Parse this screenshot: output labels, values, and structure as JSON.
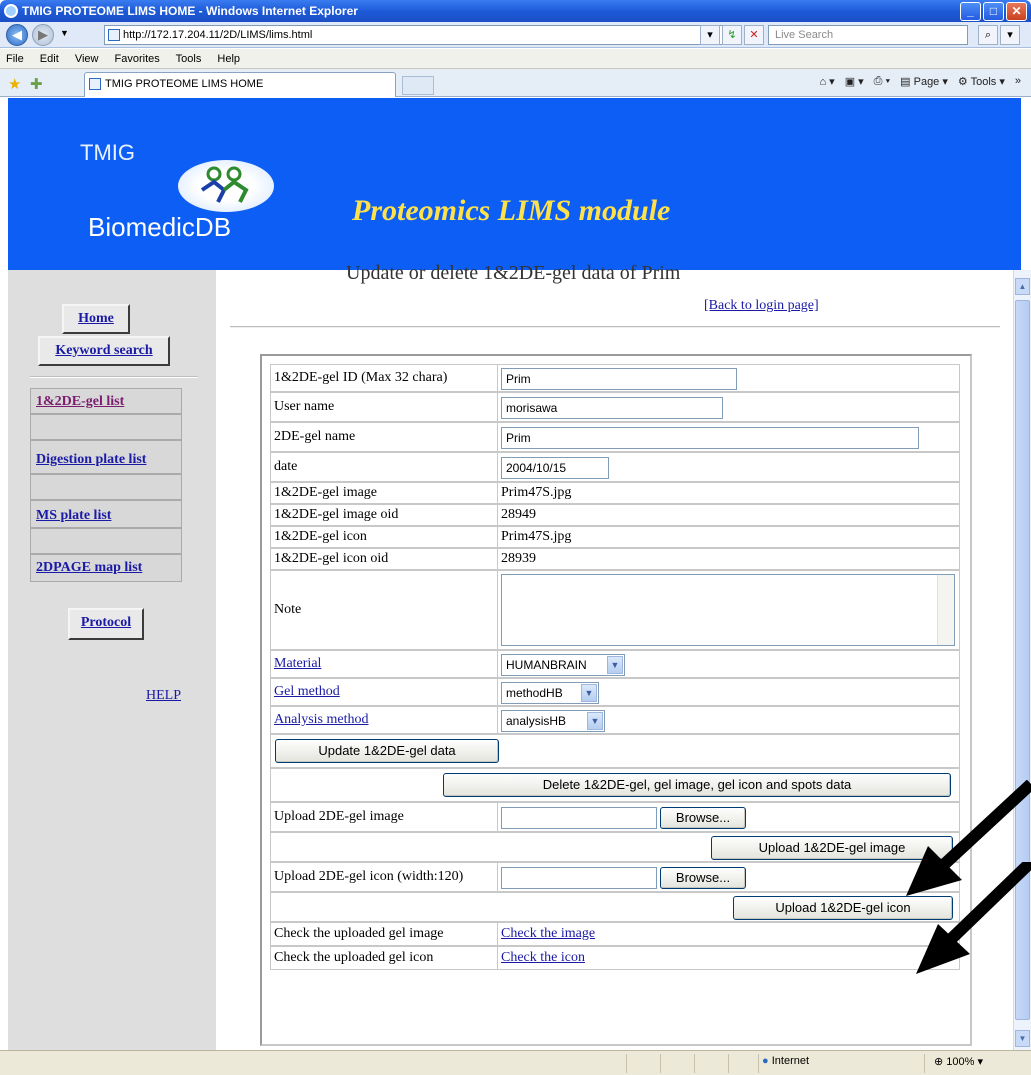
{
  "window": {
    "title": "TMIG PROTEOME LIMS HOME - Windows Internet Explorer"
  },
  "browser": {
    "url": "http://172.17.204.11/2D/LIMS/lims.html",
    "search_placeholder": "Live Search",
    "menu": [
      "File",
      "Edit",
      "View",
      "Favorites",
      "Tools",
      "Help"
    ],
    "tab_title": "TMIG PROTEOME LIMS HOME",
    "cmd_page": "Page",
    "cmd_tools": "Tools"
  },
  "banner": {
    "logo_top": "TMIG",
    "logo_bottom": "BiomedicDB",
    "title": "Proteomics LIMS module"
  },
  "sidebar": {
    "home": "Home",
    "keyword_search": "Keyword search",
    "gel_list": "1&2DE-gel list",
    "digestion_list": "Digestion plate list",
    "ms_list": "MS plate list",
    "page_map_list": "2DPAGE map list",
    "protocol": "Protocol",
    "help": "HELP"
  },
  "main": {
    "heading": "Update or delete 1&2DE-gel data of Prim",
    "back_link": "[Back to login page]"
  },
  "form": {
    "gel_id_label": "1&2DE-gel ID (Max 32 chara)",
    "gel_id_value": "Prim",
    "user_label": "User name",
    "user_value": "morisawa",
    "gel_name_label": "2DE-gel name",
    "gel_name_value": "Prim",
    "date_label": "date",
    "date_value": "2004/10/15",
    "image_label": "1&2DE-gel image",
    "image_value": "Prim47S.jpg",
    "image_oid_label": "1&2DE-gel image oid",
    "image_oid_value": "28949",
    "icon_label": "1&2DE-gel icon",
    "icon_value": "Prim47S.jpg",
    "icon_oid_label": "1&2DE-gel icon oid",
    "icon_oid_value": "28939",
    "note_label": "Note",
    "material_label": "Material",
    "material_value": "HUMANBRAIN",
    "gel_method_label": "Gel method",
    "gel_method_value": "methodHB",
    "analysis_label": "Analysis method",
    "analysis_value": "analysisHB",
    "update_button": "Update 1&2DE-gel data",
    "delete_button": "Delete 1&2DE-gel, gel image, gel icon and spots data",
    "upload_image_label": "Upload 2DE-gel image",
    "browse": "Browse...",
    "upload_image_button": "Upload 1&2DE-gel image",
    "upload_icon_label": "Upload 2DE-gel icon (width:120)",
    "upload_icon_button": "Upload 1&2DE-gel icon",
    "check_image_label": "Check the uploaded gel image",
    "check_image_link": "Check the image",
    "check_icon_label": "Check the uploaded gel icon",
    "check_icon_link": "Check the icon"
  },
  "status": {
    "zone": "Internet",
    "zoom": "100%"
  }
}
